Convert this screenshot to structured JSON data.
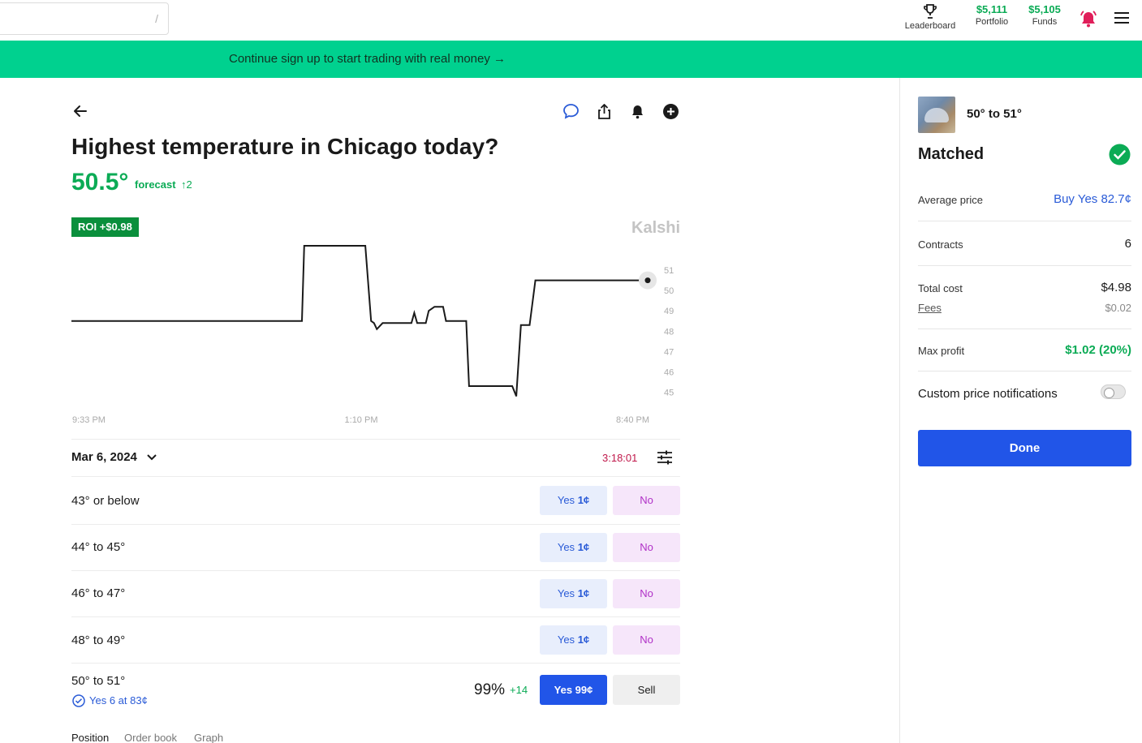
{
  "topbar": {
    "search": {
      "shortcut": "/"
    },
    "leaderboard_label": "Leaderboard",
    "portfolio_value": "$5,111",
    "portfolio_label": "Portfolio",
    "funds_value": "$5,105",
    "funds_label": "Funds",
    "icons": [
      "trophy-icon",
      "alarm-bell-icon",
      "hamburger-menu-icon"
    ]
  },
  "banner": {
    "text": "Continue sign up to start trading with real money →"
  },
  "market": {
    "title": "Highest temperature in Chicago today?",
    "forecast_value": "50.5°",
    "forecast_label": "forecast",
    "forecast_delta": "↑2",
    "roi": "ROI +$0.98",
    "brand": "Kalshi",
    "date": "Mar 6, 2024",
    "timer": "3:18:01"
  },
  "chart_data": {
    "type": "line",
    "title": "",
    "xlabel": "",
    "ylabel": "",
    "x_ticks": [
      "9:33 PM",
      "1:10 PM",
      "8:40 PM"
    ],
    "y_ticks": [
      51,
      50,
      49,
      48,
      47,
      46,
      45
    ],
    "ylim": [
      44.7,
      52.2
    ],
    "grid": false,
    "line_color": "#1a1a1a",
    "series": [
      {
        "values": [
          [
            0,
            48.5
          ],
          [
            0.4,
            48.5
          ],
          [
            0.404,
            52.2
          ],
          [
            0.51,
            52.2
          ],
          [
            0.52,
            48.5
          ],
          [
            0.525,
            48.4
          ],
          [
            0.53,
            48.1
          ],
          [
            0.54,
            48.4
          ],
          [
            0.59,
            48.4
          ],
          [
            0.595,
            48.9
          ],
          [
            0.6,
            48.4
          ],
          [
            0.615,
            48.4
          ],
          [
            0.62,
            49.0
          ],
          [
            0.63,
            49.2
          ],
          [
            0.645,
            49.2
          ],
          [
            0.65,
            48.5
          ],
          [
            0.685,
            48.5
          ],
          [
            0.69,
            45.3
          ],
          [
            0.765,
            45.3
          ],
          [
            0.772,
            44.8
          ],
          [
            0.78,
            48.3
          ],
          [
            0.795,
            48.3
          ],
          [
            0.805,
            50.5
          ],
          [
            1.0,
            50.5
          ]
        ]
      }
    ],
    "last_point": [
      1.0,
      50.5
    ]
  },
  "markets": [
    {
      "name": "43° or below",
      "yes_label": "Yes",
      "yes_price": "1¢",
      "no_label": "No"
    },
    {
      "name": "44° to 45°",
      "yes_label": "Yes",
      "yes_price": "1¢",
      "no_label": "No"
    },
    {
      "name": "46° to 47°",
      "yes_label": "Yes",
      "yes_price": "1¢",
      "no_label": "No"
    },
    {
      "name": "48° to 49°",
      "yes_label": "Yes",
      "yes_price": "1¢",
      "no_label": "No"
    }
  ],
  "owned": {
    "name": "50° to 51°",
    "percent": "99%",
    "delta": "+14",
    "yes_button": "Yes 99¢",
    "sell_button": "Sell",
    "position_text": "Yes 6 at 83¢"
  },
  "bottom_tabs": [
    "Position",
    "Order book",
    "Graph"
  ],
  "panel": {
    "market": "50° to 51°",
    "status": "Matched",
    "avg_price_label": "Average price",
    "avg_price_value": "Buy Yes 82.7¢",
    "contracts_label": "Contracts",
    "contracts_value": "6",
    "total_cost_label": "Total cost",
    "total_cost_value": "$4.98",
    "fees_label": "Fees",
    "fees_value": "$0.02",
    "max_profit_label": "Max profit",
    "max_profit_value": "$1.02 (20%)",
    "notif_label": "Custom price notifications",
    "notif_enabled": false,
    "done": "Done"
  },
  "colors": {
    "accent": "#2155e8",
    "green": "#0bab55",
    "banner": "#00d18f",
    "timer": "#c0174a",
    "no_text": "#b030c7"
  }
}
